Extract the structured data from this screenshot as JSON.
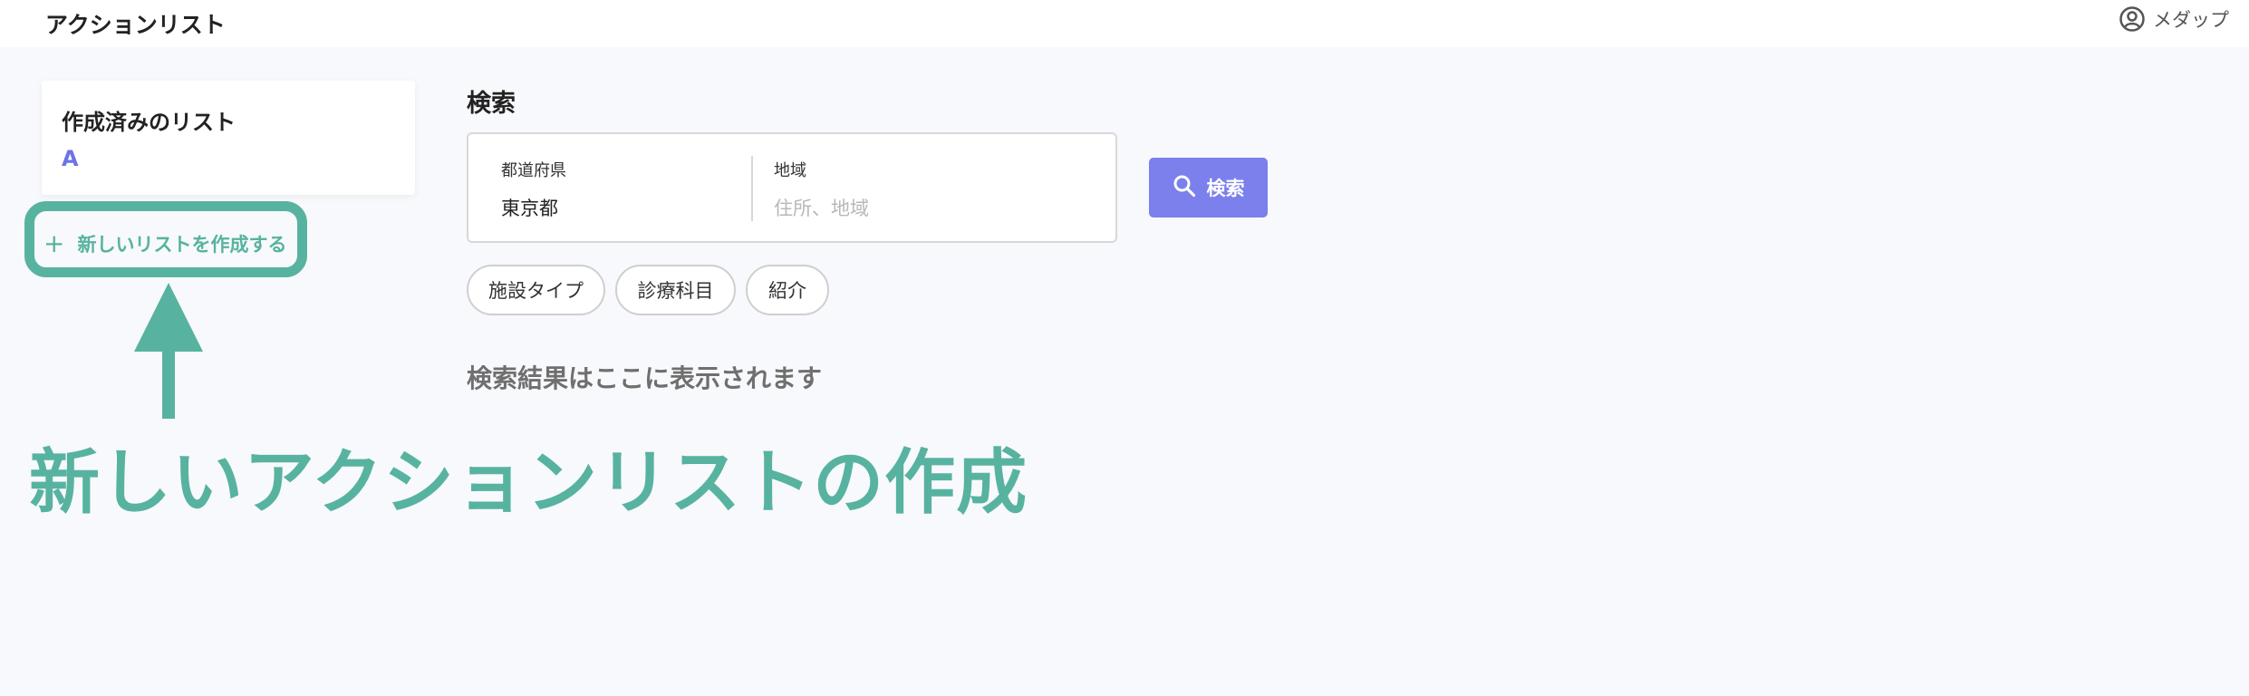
{
  "header": {
    "title": "アクションリスト",
    "user_name": "メダップ"
  },
  "sidebar": {
    "card_title": "作成済みのリスト",
    "lists": [
      "A"
    ],
    "new_list_label": "新しいリストを作成する"
  },
  "annotation": {
    "text": "新しいアクションリストの作成",
    "color": "#57b3a0"
  },
  "search": {
    "heading": "検索",
    "prefecture_label": "都道府県",
    "prefecture_value": "東京都",
    "region_label": "地域",
    "region_placeholder": "住所、地域",
    "button_label": "検索",
    "filters": [
      "施設タイプ",
      "診療科目",
      "紹介"
    ],
    "results_placeholder": "検索結果はここに表示されます"
  },
  "colors": {
    "accent": "#7b80ec",
    "link": "#6b73e6",
    "annotation": "#57b3a0",
    "background": "#f8f9fc"
  },
  "icons": [
    "user-circle-icon",
    "plus-icon",
    "search-icon",
    "up-arrow-icon"
  ]
}
